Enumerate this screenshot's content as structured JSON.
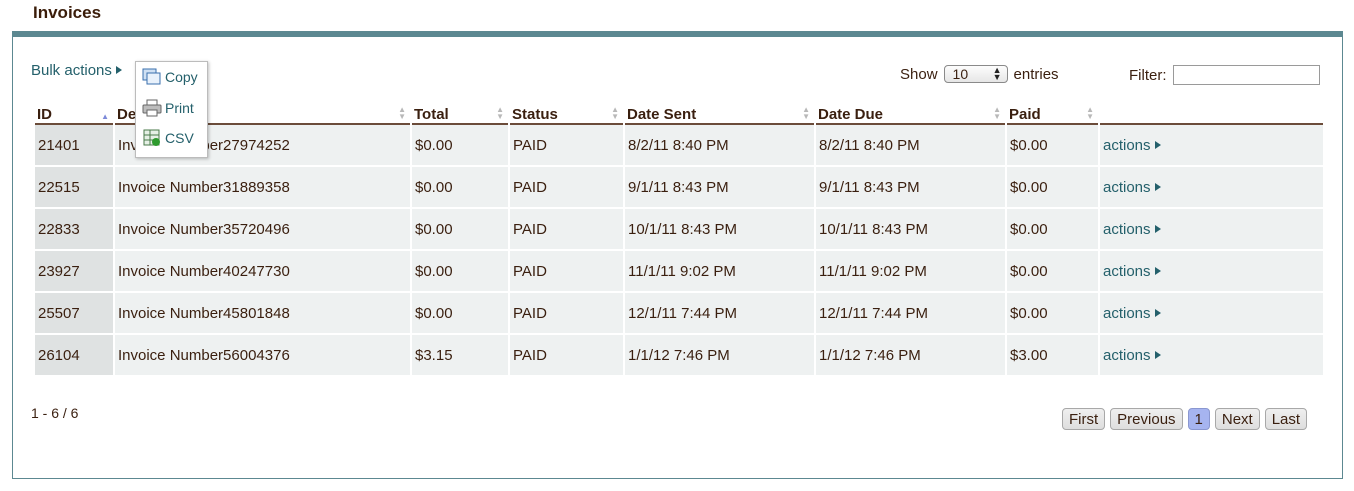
{
  "title": "Invoices",
  "bulk": {
    "label": "Bulk actions",
    "menu": [
      "Copy",
      "Print",
      "CSV"
    ]
  },
  "length": {
    "show": "Show",
    "value": "10",
    "entries": "entries"
  },
  "filter": {
    "label": "Filter:",
    "value": ""
  },
  "columns": [
    "ID",
    "Description",
    "Total",
    "Status",
    "Date Sent",
    "Date Due",
    "Paid",
    ""
  ],
  "rows": [
    {
      "id": "21401",
      "description": "Invoice Number27974252",
      "total": "$0.00",
      "status": "PAID",
      "date_sent": "8/2/11 8:40 PM",
      "date_due": "8/2/11 8:40 PM",
      "paid": "$0.00",
      "action": "actions"
    },
    {
      "id": "22515",
      "description": "Invoice Number31889358",
      "total": "$0.00",
      "status": "PAID",
      "date_sent": "9/1/11 8:43 PM",
      "date_due": "9/1/11 8:43 PM",
      "paid": "$0.00",
      "action": "actions"
    },
    {
      "id": "22833",
      "description": "Invoice Number35720496",
      "total": "$0.00",
      "status": "PAID",
      "date_sent": "10/1/11 8:43 PM",
      "date_due": "10/1/11 8:43 PM",
      "paid": "$0.00",
      "action": "actions"
    },
    {
      "id": "23927",
      "description": "Invoice Number40247730",
      "total": "$0.00",
      "status": "PAID",
      "date_sent": "11/1/11 9:02 PM",
      "date_due": "11/1/11 9:02 PM",
      "paid": "$0.00",
      "action": "actions"
    },
    {
      "id": "25507",
      "description": "Invoice Number45801848",
      "total": "$0.00",
      "status": "PAID",
      "date_sent": "12/1/11 7:44 PM",
      "date_due": "12/1/11 7:44 PM",
      "paid": "$0.00",
      "action": "actions"
    },
    {
      "id": "26104",
      "description": "Invoice Number56004376",
      "total": "$3.15",
      "status": "PAID",
      "date_sent": "1/1/12 7:46 PM",
      "date_due": "1/1/12 7:46 PM",
      "paid": "$3.00",
      "action": "actions"
    }
  ],
  "info": "1 - 6 / 6",
  "pager": {
    "first": "First",
    "previous": "Previous",
    "current": "1",
    "next": "Next",
    "last": "Last"
  },
  "colors": {
    "accent": "#24606b",
    "border": "#5c8891",
    "row_bg": "#eef1f1",
    "current_page": "#a6b4f0"
  },
  "icons": [
    "copy-icon",
    "print-icon",
    "csv-icon",
    "sort-icon",
    "triangle-right-icon"
  ]
}
